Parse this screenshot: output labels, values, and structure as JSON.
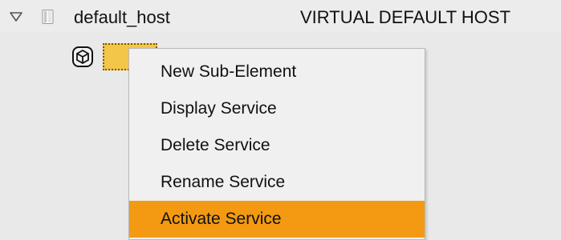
{
  "colors": {
    "background": "#e9e9e9",
    "menu_background": "#f0f0f0",
    "selected_node": "#f3c64a",
    "menu_highlight": "#f39a12"
  },
  "tree": {
    "host": {
      "expander_icon": "triangle-down-icon",
      "icon": "document-icon",
      "name": "default_host",
      "description": "VIRTUAL DEFAULT HOST"
    },
    "child": {
      "icon": "service-package-icon"
    }
  },
  "context_menu": {
    "items": [
      {
        "label": "New Sub-Element"
      },
      {
        "label": "Display Service"
      },
      {
        "label": "Delete Service"
      },
      {
        "label": "Rename Service"
      },
      {
        "label": "Activate Service"
      }
    ],
    "highlighted_item": "Activate Service"
  }
}
